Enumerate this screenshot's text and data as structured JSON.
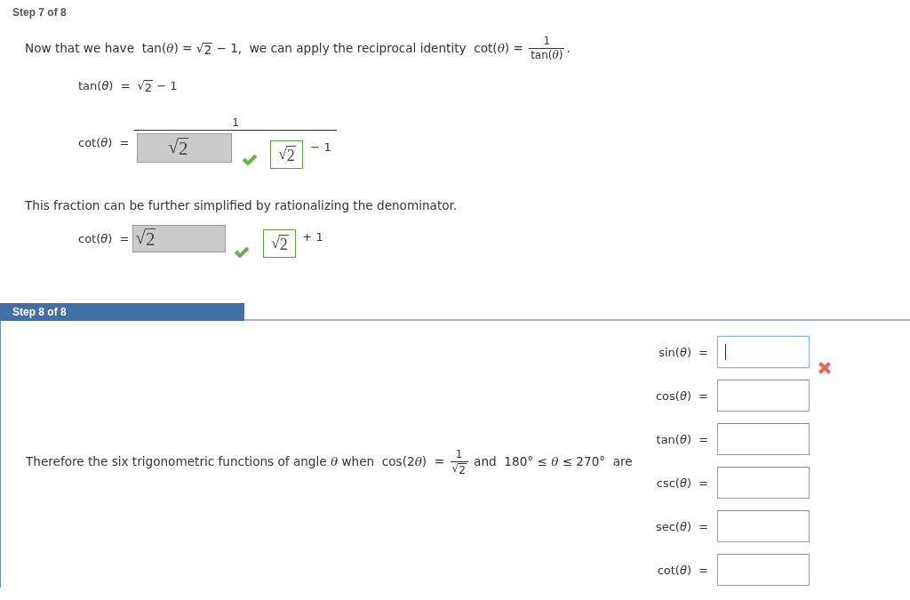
{
  "step7": {
    "header": "Step 7 of 8",
    "blocks": [
      {
        "kind": "paragraph",
        "parts": [
          {
            "kind": "text",
            "text": "Now that we have  tan("
          },
          {
            "kind": "var",
            "text": "θ"
          },
          {
            "kind": "text",
            "text": ") = "
          },
          {
            "kind": "sqrt",
            "radical": "√",
            "radicand": "2"
          },
          {
            "kind": "text",
            "text": " − 1,  we can apply the reciprocal identity  cot("
          },
          {
            "kind": "var",
            "text": "θ"
          },
          {
            "kind": "text",
            "text": ") = "
          },
          {
            "kind": "frac",
            "numerator": [
              {
                "kind": "text",
                "text": "1"
              }
            ],
            "denominator": [
              {
                "kind": "text",
                "text": "tan("
              },
              {
                "kind": "var",
                "text": "θ"
              },
              {
                "kind": "text",
                "text": ")"
              }
            ]
          },
          {
            "kind": "text",
            "text": "."
          }
        ]
      },
      {
        "kind": "equation",
        "lhs": "tan(*θ*) =",
        "rhs": [
          {
            "kind": "sqrt",
            "radical": "√",
            "radicand": "2"
          },
          {
            "kind": "text",
            "text": " − 1"
          }
        ]
      },
      {
        "kind": "fraction_answer",
        "lhs": "cot(*θ*) =",
        "numerator": "1",
        "answer": {
          "disabled": true,
          "radical": "√",
          "radicand": "2"
        },
        "correct": true,
        "preview": {
          "radical": "√",
          "radicand": "2"
        },
        "rest": "− 1"
      },
      {
        "kind": "paragraph",
        "parts": [
          {
            "kind": "text",
            "text": "This fraction can be further simplified by rationalizing the denominator."
          }
        ]
      },
      {
        "kind": "answer",
        "lhs": "cot(*θ*) =",
        "answer": {
          "disabled": true,
          "radical": "√",
          "radicand": "2"
        },
        "correct": true,
        "preview": {
          "radical": "√",
          "radicand": "2"
        },
        "rest": "+ 1"
      }
    ]
  },
  "step8": {
    "header": "Step 8 of 8",
    "sentence": [
      {
        "kind": "text",
        "text": "Therefore the six trigonometric functions of angle "
      },
      {
        "kind": "var",
        "text": "θ"
      },
      {
        "kind": "text",
        "text": " when  cos(2"
      },
      {
        "kind": "var",
        "text": "θ"
      },
      {
        "kind": "text",
        "text": ")  = "
      },
      {
        "kind": "frac",
        "numerator": [
          {
            "kind": "text",
            "text": "1"
          }
        ],
        "denominator": [
          {
            "kind": "sqrt",
            "radical": "√",
            "radicand": "2"
          }
        ]
      },
      {
        "kind": "text",
        "text": " and  180° ≤ "
      },
      {
        "kind": "var",
        "text": "θ"
      },
      {
        "kind": "text",
        "text": " ≤ 270°  are"
      }
    ],
    "fields": [
      {
        "label": "sin(*θ*) =",
        "focused": true,
        "wrong": true
      },
      {
        "label": "cos(*θ*) =",
        "focused": false,
        "wrong": false
      },
      {
        "label": "tan(*θ*) =",
        "focused": false,
        "wrong": false
      },
      {
        "label": "csc(*θ*) =",
        "focused": false,
        "wrong": false
      },
      {
        "label": "sec(*θ*) =",
        "focused": false,
        "wrong": false
      },
      {
        "label": "cot(*θ*) =",
        "focused": false,
        "wrong": false
      }
    ]
  }
}
